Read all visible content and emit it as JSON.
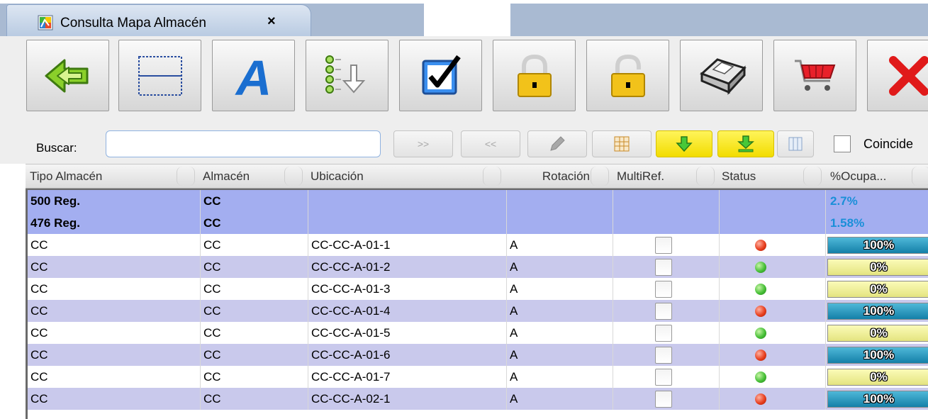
{
  "tab": {
    "title": "Consulta Mapa Almacén",
    "close": "×"
  },
  "toolbar": {
    "buttons": [
      {
        "name": "back-button",
        "icon": "back-arrow-icon"
      },
      {
        "name": "split-view-button",
        "icon": "split-view-icon"
      },
      {
        "name": "font-button",
        "icon": "font-a-icon"
      },
      {
        "name": "list-sort-button",
        "icon": "list-sort-icon"
      },
      {
        "name": "checkbox-button",
        "icon": "checkbox-checked-icon"
      },
      {
        "name": "lock-button",
        "icon": "lock-closed-icon"
      },
      {
        "name": "unlock-button",
        "icon": "lock-open-icon"
      },
      {
        "name": "print-button",
        "icon": "printer-icon"
      },
      {
        "name": "cart-button",
        "icon": "shopping-cart-icon"
      },
      {
        "name": "close-button",
        "icon": "red-x-icon"
      }
    ]
  },
  "search": {
    "label": "Buscar:",
    "value": "",
    "placeholder": "",
    "next_label": ">>",
    "prev_label": "<<",
    "checkbox_label": "Coincide"
  },
  "grid": {
    "columns": [
      "Tipo Almacén",
      "Almacén",
      "Ubicación",
      "Rotación",
      "MultiRef.",
      "Status",
      "%Ocupa..."
    ],
    "summary_rows": [
      {
        "tipo": "500 Reg.",
        "almacen": "CC",
        "pct": "2.7%"
      },
      {
        "tipo": "476 Reg.",
        "almacen": "CC",
        "pct": "1.58%"
      }
    ],
    "rows": [
      {
        "tipo": "CC",
        "almacen": "CC",
        "ubicacion": "CC-CC-A-01-1",
        "rotacion": "A",
        "multiref": false,
        "status": "red",
        "ocupacion": "100%",
        "fill": 1
      },
      {
        "tipo": "CC",
        "almacen": "CC",
        "ubicacion": "CC-CC-A-01-2",
        "rotacion": "A",
        "multiref": false,
        "status": "green",
        "ocupacion": "0%",
        "fill": 0
      },
      {
        "tipo": "CC",
        "almacen": "CC",
        "ubicacion": "CC-CC-A-01-3",
        "rotacion": "A",
        "multiref": false,
        "status": "green",
        "ocupacion": "0%",
        "fill": 0
      },
      {
        "tipo": "CC",
        "almacen": "CC",
        "ubicacion": "CC-CC-A-01-4",
        "rotacion": "A",
        "multiref": false,
        "status": "red",
        "ocupacion": "100%",
        "fill": 1
      },
      {
        "tipo": "CC",
        "almacen": "CC",
        "ubicacion": "CC-CC-A-01-5",
        "rotacion": "A",
        "multiref": false,
        "status": "green",
        "ocupacion": "0%",
        "fill": 0
      },
      {
        "tipo": "CC",
        "almacen": "CC",
        "ubicacion": "CC-CC-A-01-6",
        "rotacion": "A",
        "multiref": false,
        "status": "red",
        "ocupacion": "100%",
        "fill": 1
      },
      {
        "tipo": "CC",
        "almacen": "CC",
        "ubicacion": "CC-CC-A-01-7",
        "rotacion": "A",
        "multiref": false,
        "status": "green",
        "ocupacion": "0%",
        "fill": 0
      },
      {
        "tipo": "CC",
        "almacen": "CC",
        "ubicacion": "CC-CC-A-02-1",
        "rotacion": "A",
        "multiref": false,
        "status": "red",
        "ocupacion": "100%",
        "fill": 1
      }
    ]
  },
  "colors": {
    "summary_row_bg": "#a3aef0",
    "alt_row_bg": "#c9c9ec",
    "row_bg": "#ffffff",
    "status_red": "#e84020",
    "status_green": "#48c038",
    "bar_full": "#1480a8",
    "bar_empty": "#e4e480",
    "summary_pct_text": "#1a8fd8"
  }
}
